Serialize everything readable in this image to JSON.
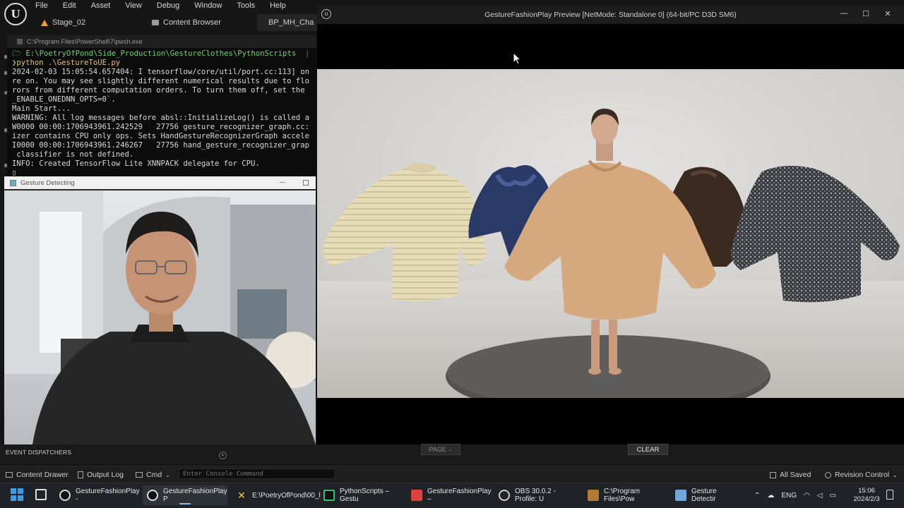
{
  "ue": {
    "menu": [
      "File",
      "Edit",
      "Asset",
      "View",
      "Debug",
      "Window",
      "Tools",
      "Help"
    ],
    "tabs": [
      {
        "label": "Stage_02",
        "color": "#f0a030"
      },
      {
        "label": "Content Browser",
        "color": "#9a9a9a"
      },
      {
        "label": "BP_MH_Cha",
        "color": "#4a90e2"
      }
    ]
  },
  "terminal": {
    "title": "C:\\Program Files\\PowerShell\\7\\pwsh.exe",
    "path": "E:\\PoetryOfPond\\Side_Production\\GestureClothes\\PythonScripts",
    "command": "python .\\GestureToUE.py",
    "lines": [
      "2024-02-03 15:05:54.657404: I tensorflow/core/util/port.cc:113] on",
      "re on. You may see slightly different numerical results due to flo",
      "rors from different computation orders. To turn them off, set the",
      "_ENABLE_ONEDNN_OPTS=0`.",
      "Main Start...",
      "WARNING: All log messages before absl::InitializeLog() is called a",
      "W0000 00:00:1706943961.242529   27756 gesture_recognizer_graph.cc:",
      "izer contains CPU only ops. Sets HandGestureRecognizerGraph accele",
      "I0000 00:00:1706943961.246267   27756 hand_gesture_recognizer_grap",
      " classifier is not defined.",
      "INFO: Created TensorFlow Lite XNNPACK delegate for CPU."
    ]
  },
  "cam": {
    "title": "Gesture Detecting"
  },
  "preview": {
    "title": "GestureFashionPlay Preview [NetMode: Standalone 0]  (64-bit/PC D3D SM6)"
  },
  "panel": {
    "event_dispatchers": "EVENT DISPATCHERS",
    "page_label": "PAGE",
    "clear_label": "CLEAR"
  },
  "statusbar": {
    "content_drawer": "Content Drawer",
    "output_log": "Output Log",
    "cmd": "Cmd",
    "console_placeholder": "Enter Console Command",
    "all_saved": "All Saved",
    "revision_control": "Revision Control"
  },
  "taskbar": {
    "apps": [
      {
        "label": "GestureFashionPlay -",
        "color": "#dcdcdc",
        "active": false
      },
      {
        "label": "GestureFashionPlay P",
        "color": "#dcdcdc",
        "active": true
      },
      {
        "label": "E:\\PoetryOfPond\\00_l",
        "color": "#f5c542",
        "active": false
      },
      {
        "label": "PythonScripts – Gestu",
        "color": "#35c46b",
        "active": false
      },
      {
        "label": "GestureFashionPlay –",
        "color": "#d9453a",
        "active": false
      },
      {
        "label": "OBS 30.0.2 - Profile: U",
        "color": "#cfcfcf",
        "active": false
      },
      {
        "label": "C:\\Program Files\\Pow",
        "color": "#b37a34",
        "active": false
      },
      {
        "label": "Gesture Detectir",
        "color": "#6fa8dc",
        "active": false
      }
    ],
    "lang": "ENG",
    "time": "15:06",
    "date": "2024/2/3"
  }
}
